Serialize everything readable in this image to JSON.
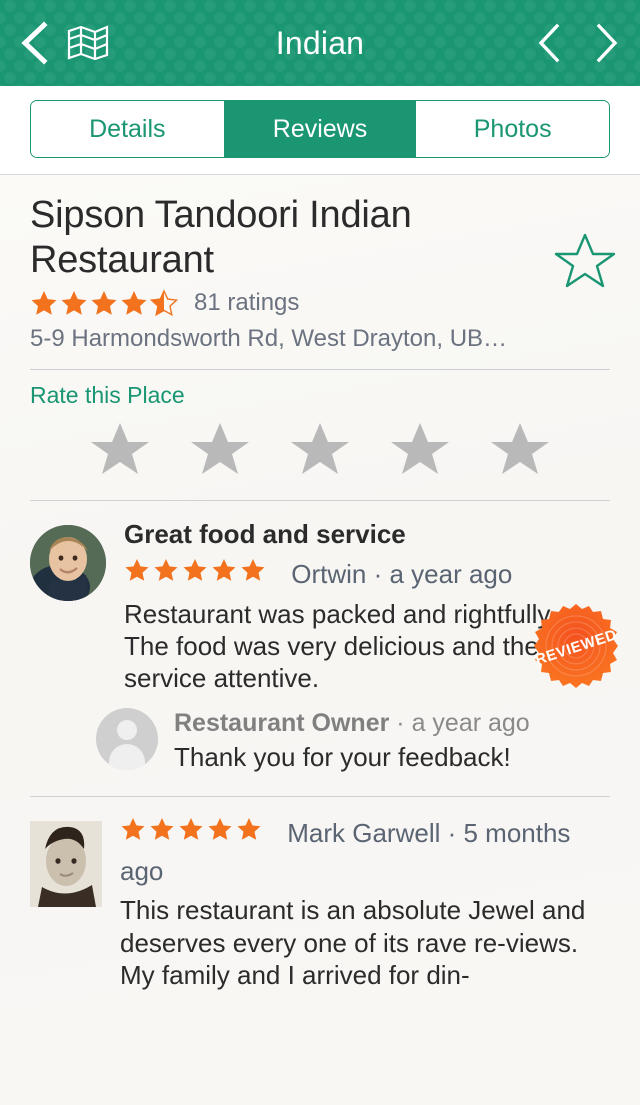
{
  "header": {
    "title": "Indian",
    "back_icon": "chevron-left-icon",
    "map_icon": "map-icon",
    "prev_icon": "chevron-left-icon",
    "next_icon": "chevron-right-icon",
    "bg_color": "#1a9673"
  },
  "tabs": {
    "items": [
      {
        "label": "Details",
        "active": false
      },
      {
        "label": "Reviews",
        "active": true
      },
      {
        "label": "Photos",
        "active": false
      }
    ]
  },
  "place": {
    "name": "Sipson Tandoori Indian Restaurant",
    "rating": 4.5,
    "ratings_count_label": "81 ratings",
    "address": "5-9 Harmondsworth Rd, West Drayton, UB…",
    "favorite_icon": "star-outline-icon",
    "favorite_active": false
  },
  "rate": {
    "label": "Rate this Place",
    "stars": 0,
    "star_count": 5
  },
  "reviews": [
    {
      "title": "Great food and service",
      "stars": 5,
      "author": "Ortwin",
      "separator": "·",
      "time": "a year ago",
      "text": "Restaurant was packed and rightfully so. The food was very delicious and the service attentive.",
      "badge": "REVIEWED",
      "reply": {
        "author": "Restaurant Owner",
        "separator": "·",
        "time": "a year ago",
        "text": "Thank you for your feedback!"
      }
    },
    {
      "title": "",
      "stars": 5,
      "author": "Mark Garwell",
      "separator": "·",
      "time": "5 months ago",
      "text": "This restaurant is an absolute Jewel and deserves every one of its rave re-views. My family and I arrived for din-"
    }
  ],
  "colors": {
    "brand_green": "#1a9673",
    "star_orange": "#f2721d",
    "badge_orange": "#f4511e",
    "muted_text": "#6b7280"
  }
}
